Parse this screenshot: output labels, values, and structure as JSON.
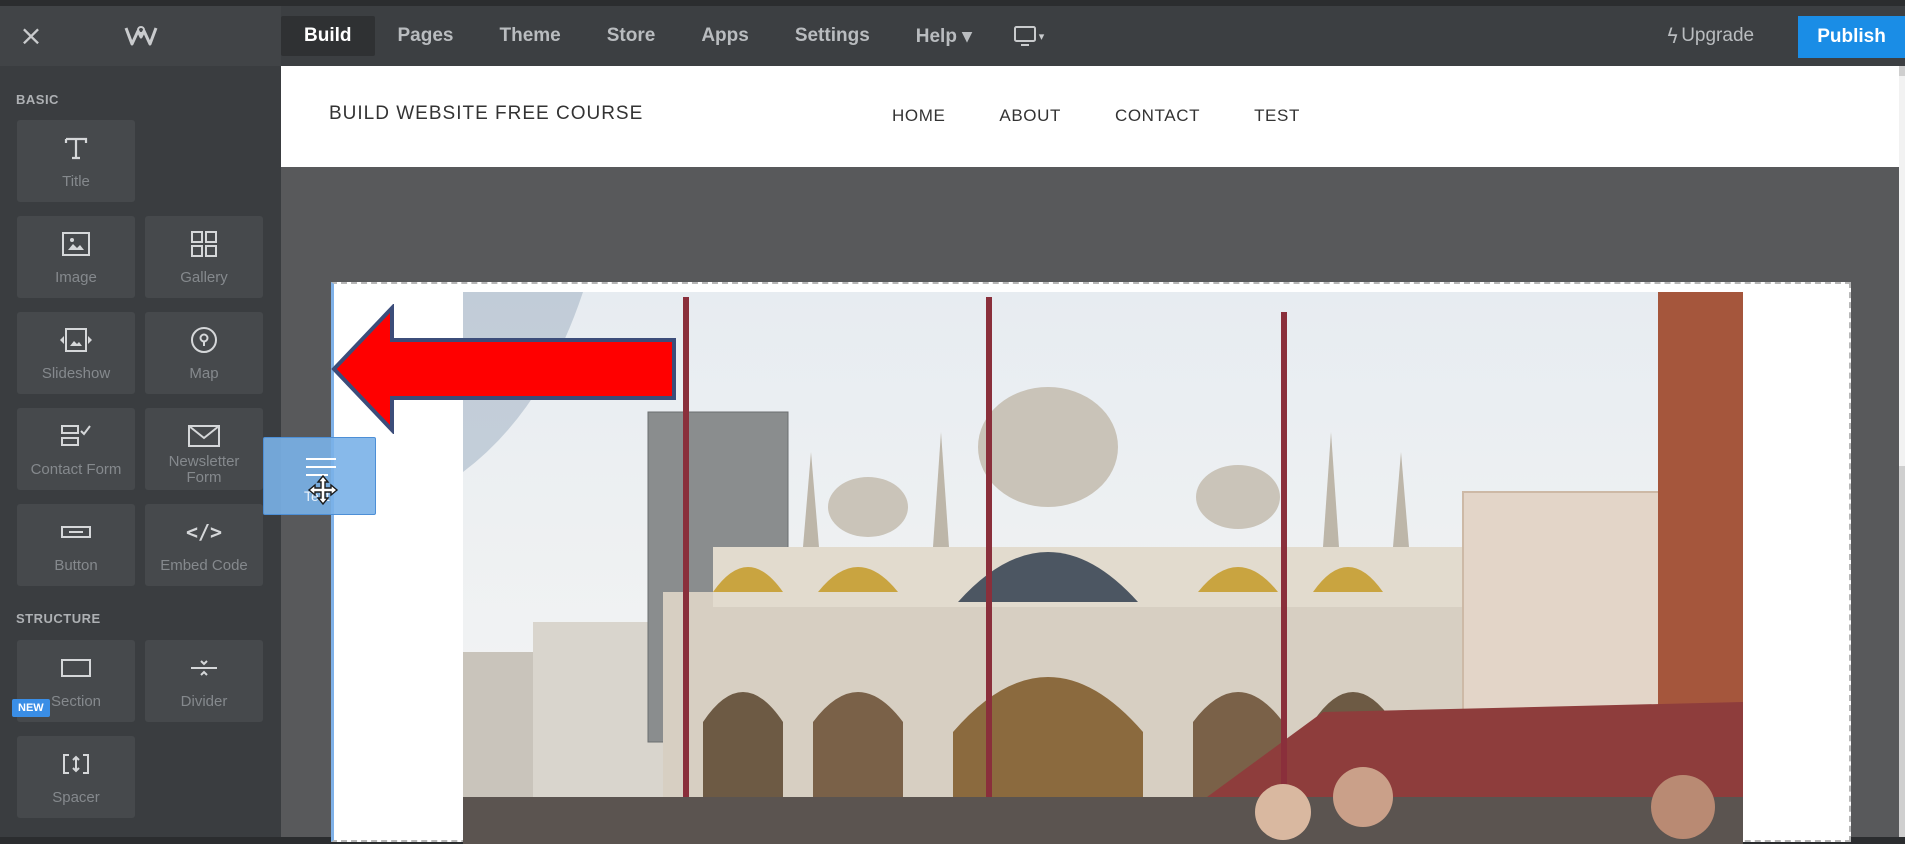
{
  "topbar": {
    "close_icon": "×",
    "logo": "weebly-logo",
    "nav": [
      {
        "label": "Build",
        "active": true
      },
      {
        "label": "Pages",
        "active": false
      },
      {
        "label": "Theme",
        "active": false
      },
      {
        "label": "Store",
        "active": false
      },
      {
        "label": "Apps",
        "active": false
      },
      {
        "label": "Settings",
        "active": false
      },
      {
        "label": "Help ▾",
        "active": false
      }
    ],
    "device_icon": "desktop-icon",
    "device_caret": "▾",
    "upgrade_label": "Upgrade",
    "publish_label": "Publish"
  },
  "sidebar": {
    "basic_label": "BASIC",
    "structure_label": "STRUCTURE",
    "new_badge": "NEW",
    "items": [
      {
        "label": "Title",
        "icon": "title-icon"
      },
      {
        "label": "Image",
        "icon": "image-icon"
      },
      {
        "label": "Gallery",
        "icon": "gallery-icon"
      },
      {
        "label": "Slideshow",
        "icon": "slideshow-icon"
      },
      {
        "label": "Map",
        "icon": "map-pin-icon"
      },
      {
        "label": "Contact Form",
        "icon": "contact-form-icon"
      },
      {
        "label": "Newsletter Form",
        "icon": "envelope-icon"
      },
      {
        "label": "Button",
        "icon": "button-icon"
      },
      {
        "label": "Embed Code",
        "icon": "code-icon"
      },
      {
        "label": "Section",
        "icon": "section-icon"
      },
      {
        "label": "Divider",
        "icon": "divider-icon"
      },
      {
        "label": "Spacer",
        "icon": "spacer-icon"
      }
    ]
  },
  "drag_ghost": {
    "label": "Text",
    "icon": "text-icon"
  },
  "site": {
    "title": "BUILD WEBSITE FREE COURSE",
    "nav": [
      "HOME",
      "ABOUT",
      "CONTACT",
      "TEST"
    ]
  },
  "colors": {
    "publish": "#1a8de6",
    "arrow": "#ff0000",
    "topbar": "#3c3f42",
    "sidebar": "#3a3d40"
  }
}
